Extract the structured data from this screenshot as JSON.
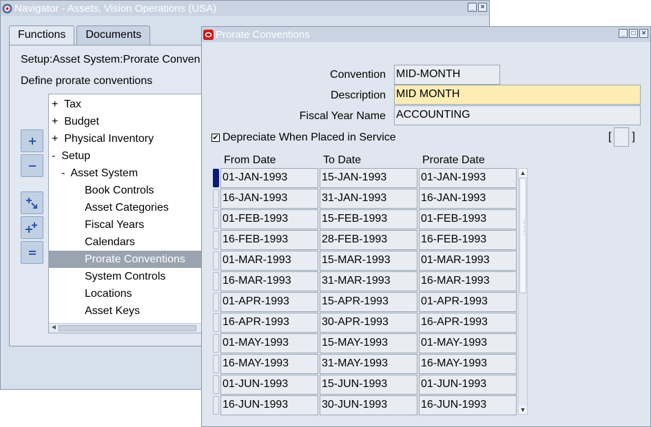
{
  "navigator": {
    "title": "Navigator - Assets, Vision Operations (USA)",
    "tabs": [
      "Functions",
      "Documents"
    ],
    "path": "Setup:Asset System:Prorate Conven",
    "description": "Define prorate conventions",
    "tree": [
      {
        "prefix": "+",
        "label": "Tax",
        "indent": 0
      },
      {
        "prefix": "+",
        "label": "Budget",
        "indent": 0
      },
      {
        "prefix": "+",
        "label": "Physical Inventory",
        "indent": 0
      },
      {
        "prefix": "-",
        "label": "Setup",
        "indent": 0
      },
      {
        "prefix": "-",
        "label": "Asset System",
        "indent": 1
      },
      {
        "prefix": "",
        "label": "Book Controls",
        "indent": 2
      },
      {
        "prefix": "",
        "label": "Asset Categories",
        "indent": 2
      },
      {
        "prefix": "",
        "label": "Fiscal Years",
        "indent": 2
      },
      {
        "prefix": "",
        "label": "Calendars",
        "indent": 2
      },
      {
        "prefix": "",
        "label": "Prorate Conventions",
        "indent": 2,
        "selected": true
      },
      {
        "prefix": "",
        "label": "System Controls",
        "indent": 2
      },
      {
        "prefix": "",
        "label": "Locations",
        "indent": 2
      },
      {
        "prefix": "",
        "label": "Asset Keys",
        "indent": 2
      }
    ],
    "side_buttons": [
      "expand-icon",
      "collapse-icon",
      "expand-branch-icon",
      "expand-all-icon",
      "collapse-all-icon"
    ]
  },
  "form": {
    "title": "Prorate Conventions",
    "convention_label": "Convention",
    "convention_value": "MID-MONTH",
    "description_label": "Description",
    "description_value": "MID MONTH",
    "fiscal_year_label": "Fiscal Year Name",
    "fiscal_year_value": "ACCOUNTING",
    "checkbox_label": "Depreciate When Placed in Service",
    "checkbox_checked": true,
    "bracket_open": "[",
    "bracket_close": "]",
    "columns": [
      "From Date",
      "To Date",
      "Prorate Date"
    ],
    "rows": [
      [
        "01-JAN-1993",
        "15-JAN-1993",
        "01-JAN-1993"
      ],
      [
        "16-JAN-1993",
        "31-JAN-1993",
        "16-JAN-1993"
      ],
      [
        "01-FEB-1993",
        "15-FEB-1993",
        "01-FEB-1993"
      ],
      [
        "16-FEB-1993",
        "28-FEB-1993",
        "16-FEB-1993"
      ],
      [
        "01-MAR-1993",
        "15-MAR-1993",
        "01-MAR-1993"
      ],
      [
        "16-MAR-1993",
        "31-MAR-1993",
        "16-MAR-1993"
      ],
      [
        "01-APR-1993",
        "15-APR-1993",
        "01-APR-1993"
      ],
      [
        "16-APR-1993",
        "30-APR-1993",
        "16-APR-1993"
      ],
      [
        "01-MAY-1993",
        "15-MAY-1993",
        "01-MAY-1993"
      ],
      [
        "16-MAY-1993",
        "31-MAY-1993",
        "16-MAY-1993"
      ],
      [
        "01-JUN-1993",
        "15-JUN-1993",
        "01-JUN-1993"
      ],
      [
        "16-JUN-1993",
        "30-JUN-1993",
        "16-JUN-1993"
      ]
    ]
  },
  "colors": {
    "required_field": "#fdedb5",
    "selected_tree_row": "#9aa3b0",
    "current_record": "#0b1b7a",
    "oracle_red": "#cc1a1a"
  }
}
